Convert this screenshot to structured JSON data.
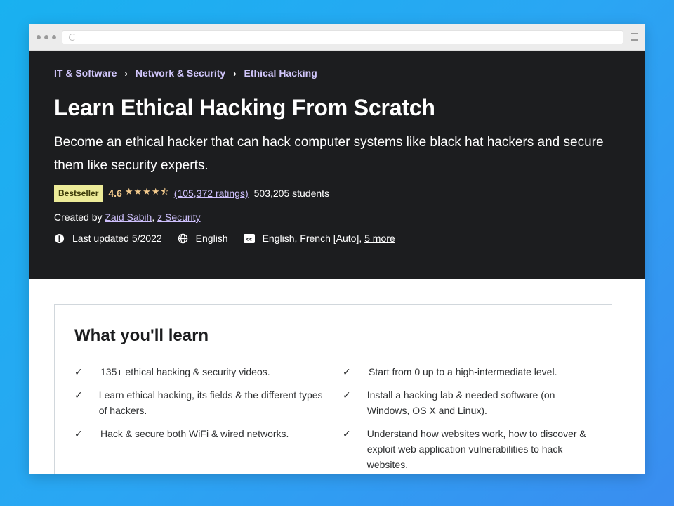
{
  "breadcrumb": [
    "IT & Software",
    "Network & Security",
    "Ethical Hacking"
  ],
  "course": {
    "title": "Learn Ethical Hacking From Scratch",
    "subtitle": "Become an ethical hacker that can hack computer systems like black hat hackers and secure them like security experts.",
    "badge": "Bestseller",
    "rating": "4.6",
    "stars_value": 4.5,
    "ratings_count": "(105,372 ratings)",
    "students": "503,205 students",
    "created_prefix": "Created by",
    "authors": [
      "Zaid Sabih",
      "z Security"
    ],
    "author_separator": ", ",
    "last_updated": "Last updated 5/2022",
    "language": "English",
    "captions": "English, French [Auto],",
    "captions_more": "5 more"
  },
  "learn": {
    "title": "What you'll learn",
    "left_items": [
      "135+ ethical hacking & security videos.",
      "Learn ethical hacking, its fields & the different types of hackers.",
      "Hack & secure both WiFi & wired networks."
    ],
    "right_items": [
      "Start from 0 up to a high-intermediate level.",
      "Install a hacking lab & needed software (on Windows, OS X and Linux).",
      "Understand how websites work, how to discover & exploit web application vulnerabilities to hack websites."
    ]
  },
  "colors": {
    "hero_bg": "#1c1d1f",
    "link_purple": "#cec0fc",
    "star": "#f3ca8c",
    "badge_bg": "#eceb98"
  },
  "icons": [
    "reload-icon",
    "menu-icon",
    "chevron-right-icon",
    "star-icon",
    "alert-icon",
    "globe-icon",
    "closed-caption-icon",
    "check-icon"
  ]
}
